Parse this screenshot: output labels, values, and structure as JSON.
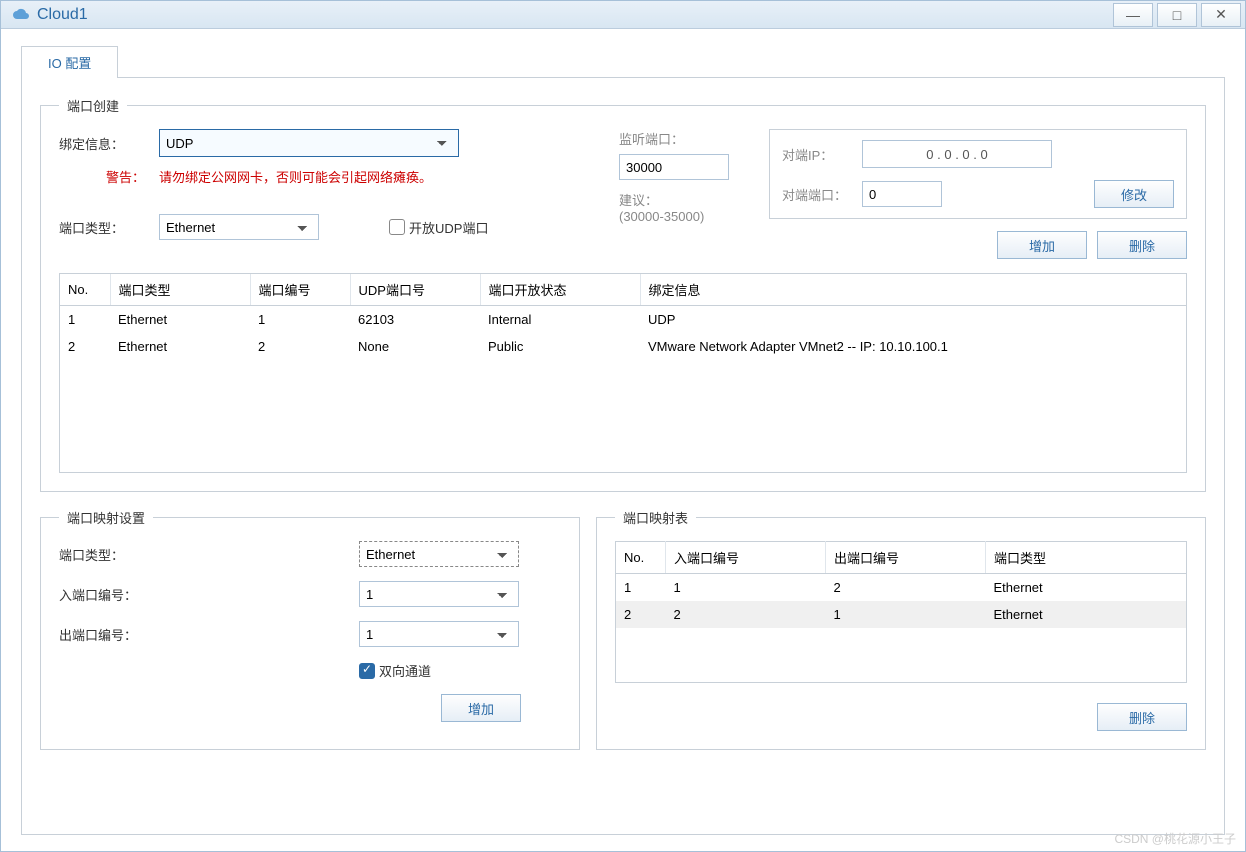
{
  "window": {
    "title": "Cloud1",
    "minimize_alt": "minimize",
    "maximize_alt": "maximize",
    "close_alt": "close"
  },
  "tab": {
    "label": "IO 配置"
  },
  "port_create": {
    "legend": "端口创建",
    "bind_label": "绑定信息：",
    "bind_value": "UDP",
    "warn_label": "警告：",
    "warn_text": "请勿绑定公网网卡，否则可能会引起网络瘫痪。",
    "port_type_label": "端口类型：",
    "port_type_value": "Ethernet",
    "open_udp_label": "开放UDP端口",
    "listen_label": "监听端口：",
    "listen_value": "30000",
    "suggest_label": "建议：",
    "suggest_range": "(30000-35000)",
    "peer_ip_label": "对端IP：",
    "peer_ip_value": "0   .   0   .   0   .   0",
    "peer_port_label": "对端端口：",
    "peer_port_value": "0",
    "modify_btn": "修改",
    "add_btn": "增加",
    "delete_btn": "删除",
    "table_headers": {
      "no": "No.",
      "type": "端口类型",
      "pno": "端口编号",
      "udp": "UDP端口号",
      "open": "端口开放状态",
      "bind": "绑定信息"
    },
    "rows": [
      {
        "no": "1",
        "type": "Ethernet",
        "pno": "1",
        "udp": "62103",
        "open": "Internal",
        "bind": "UDP"
      },
      {
        "no": "2",
        "type": "Ethernet",
        "pno": "2",
        "udp": "None",
        "open": "Public",
        "bind": "VMware Network Adapter VMnet2 -- IP: 10.10.100.1"
      }
    ]
  },
  "port_map_set": {
    "legend": "端口映射设置",
    "port_type_label": "端口类型：",
    "port_type_value": "Ethernet",
    "in_label": "入端口编号：",
    "in_value": "1",
    "out_label": "出端口编号：",
    "out_value": "1",
    "bidir_label": "双向通道",
    "add_btn": "增加"
  },
  "port_map_table": {
    "legend": "端口映射表",
    "headers": {
      "no": "No.",
      "in": "入端口编号",
      "out": "出端口编号",
      "type": "端口类型"
    },
    "rows": [
      {
        "no": "1",
        "in": "1",
        "out": "2",
        "type": "Ethernet"
      },
      {
        "no": "2",
        "in": "2",
        "out": "1",
        "type": "Ethernet"
      }
    ],
    "delete_btn": "删除"
  },
  "watermark": "CSDN @桃花源小王子"
}
